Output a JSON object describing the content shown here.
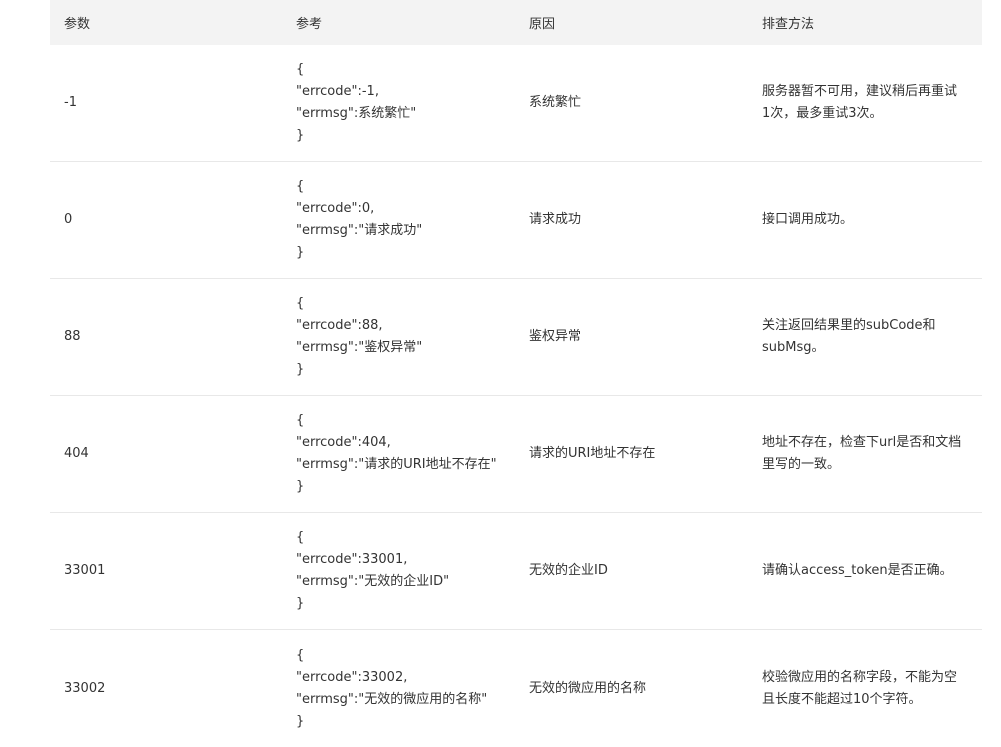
{
  "headers": [
    "参数",
    "参考",
    "原因",
    "排查方法"
  ],
  "rows": [
    {
      "param": "-1",
      "ref": [
        "{",
        "\"errcode\":-1,",
        "\"errmsg\":系统繁忙\"",
        "}"
      ],
      "reason": "系统繁忙",
      "fix": "服务器暂不可用，建议稍后再重试1次，最多重试3次。"
    },
    {
      "param": "0",
      "ref": [
        "{",
        "\"errcode\":0,",
        "\"errmsg\":\"请求成功\"",
        "}"
      ],
      "reason": "请求成功",
      "fix": "接口调用成功。"
    },
    {
      "param": "88",
      "ref": [
        "{",
        "\"errcode\":88,",
        "\"errmsg\":\"鉴权异常\"",
        "}"
      ],
      "reason": "鉴权异常",
      "fix": "关注返回结果里的subCode和subMsg。"
    },
    {
      "param": "404",
      "ref": [
        "{",
        "\"errcode\":404,",
        "\"errmsg\":\"请求的URI地址不存在\"",
        "}"
      ],
      "reason": "请求的URI地址不存在",
      "fix": "地址不存在，检查下url是否和文档里写的一致。"
    },
    {
      "param": "33001",
      "ref": [
        "{",
        "\"errcode\":33001,",
        "\"errmsg\":\"无效的企业ID\"",
        "}"
      ],
      "reason": "无效的企业ID",
      "fix": "请确认access_token是否正确。"
    },
    {
      "param": "33002",
      "ref": [
        "{",
        "\"errcode\":33002,",
        "\"errmsg\":\"无效的微应用的名称\"",
        "}"
      ],
      "reason": "无效的微应用的名称",
      "fix": "校验微应用的名称字段，不能为空且长度不能超过10个字符。"
    }
  ]
}
